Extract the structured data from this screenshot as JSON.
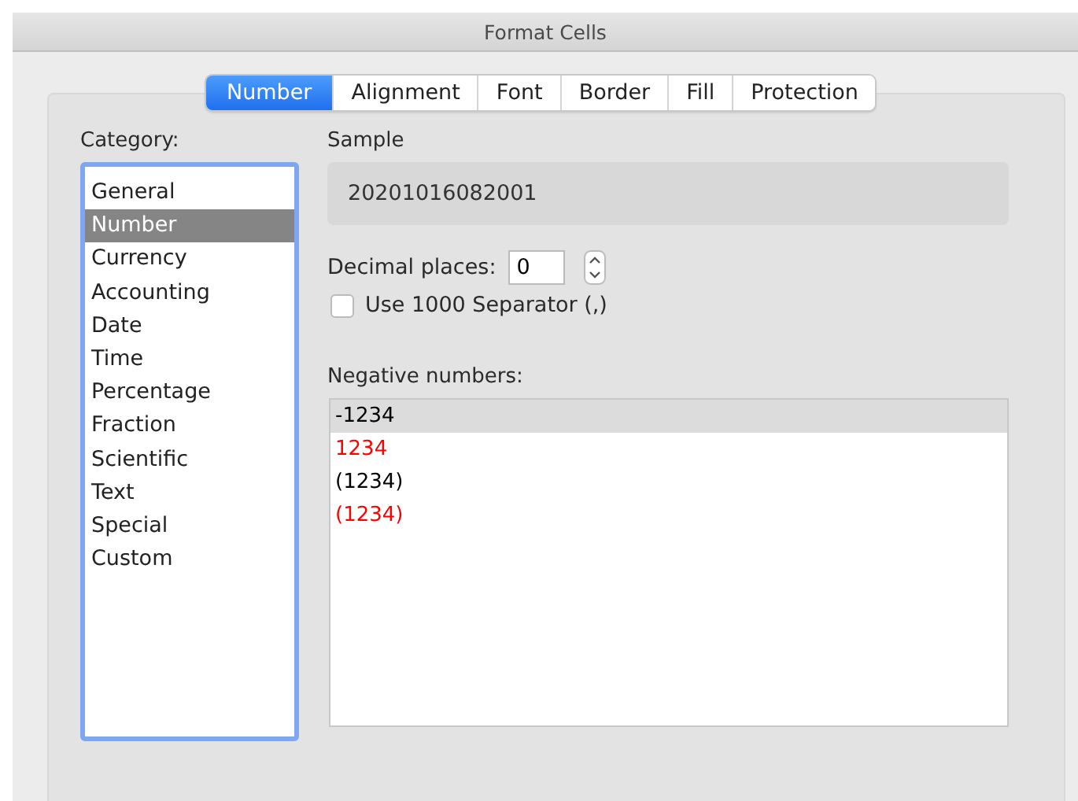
{
  "window": {
    "title": "Format Cells"
  },
  "tabs": [
    {
      "label": "Number",
      "selected": true
    },
    {
      "label": "Alignment",
      "selected": false
    },
    {
      "label": "Font",
      "selected": false
    },
    {
      "label": "Border",
      "selected": false
    },
    {
      "label": "Fill",
      "selected": false
    },
    {
      "label": "Protection",
      "selected": false
    }
  ],
  "category": {
    "label": "Category:",
    "items": [
      {
        "label": "General",
        "selected": false
      },
      {
        "label": "Number",
        "selected": true
      },
      {
        "label": "Currency",
        "selected": false
      },
      {
        "label": "Accounting",
        "selected": false
      },
      {
        "label": "Date",
        "selected": false
      },
      {
        "label": "Time",
        "selected": false
      },
      {
        "label": "Percentage",
        "selected": false
      },
      {
        "label": "Fraction",
        "selected": false
      },
      {
        "label": "Scientific",
        "selected": false
      },
      {
        "label": "Text",
        "selected": false
      },
      {
        "label": "Special",
        "selected": false
      },
      {
        "label": "Custom",
        "selected": false
      }
    ]
  },
  "sample": {
    "label": "Sample",
    "value": "20201016082001"
  },
  "decimal_places": {
    "label": "Decimal places:",
    "value": "0"
  },
  "separator": {
    "label": "Use 1000 Separator (,)",
    "checked": false
  },
  "negative_numbers": {
    "label": "Negative numbers:",
    "items": [
      {
        "label": "-1234",
        "color": "#000000",
        "selected": true
      },
      {
        "label": "1234",
        "color": "#ff0000",
        "selected": false
      },
      {
        "label": "(1234)",
        "color": "#000000",
        "selected": false
      },
      {
        "label": "(1234)",
        "color": "#ff0000",
        "selected": false
      }
    ]
  }
}
